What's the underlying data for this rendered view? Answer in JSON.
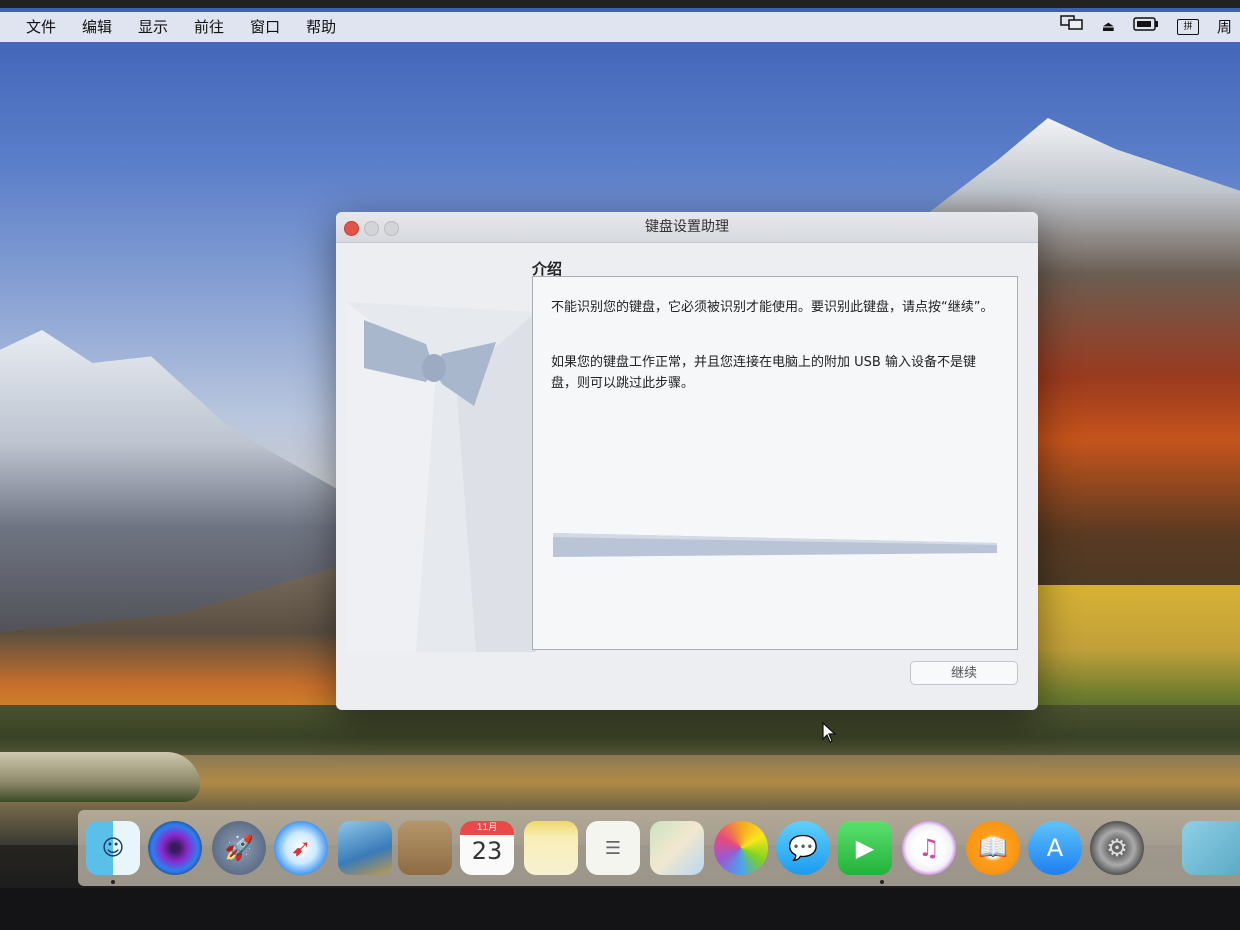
{
  "menubar": {
    "items": [
      "文件",
      "编辑",
      "显示",
      "前往",
      "窗口",
      "帮助"
    ],
    "right_icons": [
      "display-mirroring-icon",
      "eject-icon",
      "battery-icon",
      "input-method-icon"
    ],
    "clock_fragment": "周"
  },
  "window": {
    "title": "键盘设置助理",
    "section_title": "介绍",
    "paragraph_1": "不能识别您的键盘，它必须被识别才能使用。要识别此键盘，请点按“继续”。",
    "paragraph_2": "如果您的键盘工作正常，并且您连接在电脑上的附加 USB 输入设备不是键盘，则可以跳过此步骤。",
    "continue_label": "继续"
  },
  "dock": {
    "apps": [
      "finder",
      "siri",
      "launchpad",
      "safari",
      "photo-booth",
      "contacts",
      "calendar",
      "notes",
      "reminders",
      "maps",
      "photos",
      "messages",
      "facetime",
      "itunes",
      "ibooks",
      "app-store",
      "system-preferences",
      "downloads"
    ],
    "calendar_month": "11月",
    "calendar_day": "23"
  }
}
